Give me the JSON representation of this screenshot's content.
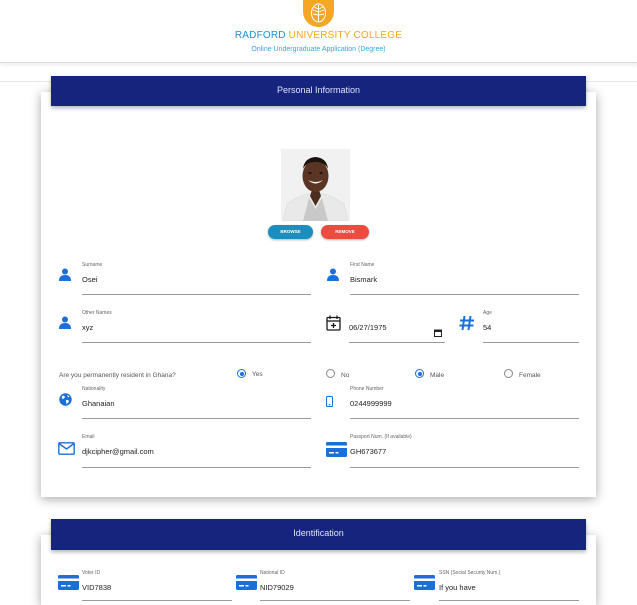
{
  "header": {
    "brand_part1": "RADFORD",
    "brand_part2": " UNIVERSITY COLLEGE",
    "subtitle": "Online Undergraduate Application (Degree)"
  },
  "personal": {
    "title": "Personal Information",
    "browse_label": "BROWSE",
    "remove_label": "REMOVE",
    "surname": {
      "label": "Surname",
      "value": "Osei",
      "icon": "person-icon"
    },
    "first_name": {
      "label": "First Name",
      "value": "Bismark",
      "icon": "person-icon"
    },
    "other_names": {
      "label": "Other Names",
      "value": "xyz",
      "icon": "person-icon"
    },
    "dob": {
      "value": "06/27/1975",
      "icon": "calendar-add-icon"
    },
    "age": {
      "label": "Age",
      "value": "54",
      "icon": "hash-icon"
    },
    "resident_question": "Are you permanently resident in Ghana?",
    "resident_options": [
      "Yes",
      "No"
    ],
    "resident_selected": "Yes",
    "gender_options": [
      "Male",
      "Female"
    ],
    "gender_selected": "Male",
    "nationality": {
      "label": "Nationality",
      "value": "Ghanaian",
      "icon": "globe-icon"
    },
    "phone": {
      "label": "Phone Number",
      "value": "0244999999",
      "icon": "phone-icon"
    },
    "email": {
      "label": "Email",
      "value": "djkcipher@gmail.com",
      "icon": "mail-icon"
    },
    "passport": {
      "label": "Passport Num. (If available)",
      "value": "GH673677",
      "icon": "card-icon"
    }
  },
  "identification": {
    "title": "Identification",
    "voter_id": {
      "label": "Voter ID",
      "value": "VID7838",
      "icon": "card-icon"
    },
    "national_id": {
      "label": "National ID",
      "value": "NID79029",
      "icon": "card-icon"
    },
    "ssn": {
      "label": "SSN (Social Security Num.)",
      "value": "If you have",
      "icon": "card-icon"
    }
  },
  "colors": {
    "header_bar": "#16247e",
    "icon_blue": "#1a6fd8",
    "brand_blue": "#1a8fd8",
    "brand_gold": "#f0a818",
    "browse": "#1a8fbf",
    "remove": "#ee4a40"
  }
}
